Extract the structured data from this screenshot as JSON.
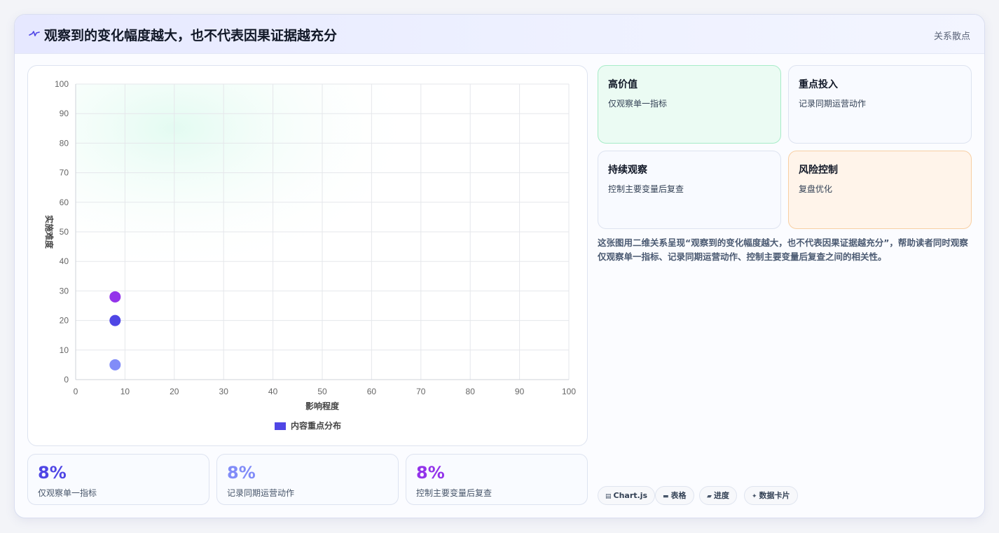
{
  "header": {
    "icon": "pulse-icon",
    "title": "观察到的变化幅度越大，也不代表因果证据越充分",
    "tag": "关系散点"
  },
  "chart_data": {
    "type": "scatter",
    "xlabel": "影响程度",
    "ylabel": "实施难度",
    "xlim": [
      0,
      100
    ],
    "ylim": [
      0,
      100
    ],
    "xticks": [
      0,
      10,
      20,
      30,
      40,
      50,
      60,
      70,
      80,
      90,
      100
    ],
    "yticks": [
      0,
      10,
      20,
      30,
      40,
      50,
      60,
      70,
      80,
      90,
      100
    ],
    "grid": true,
    "legend": "bottom",
    "series": [
      {
        "name": "内容重点分布",
        "color": "#4f46e5",
        "points": [
          {
            "x": 8,
            "y": 28,
            "color": "#9333ea"
          },
          {
            "x": 8,
            "y": 20,
            "color": "#4f46e5"
          },
          {
            "x": 8,
            "y": 5,
            "color": "#818cf8"
          }
        ]
      }
    ]
  },
  "stats": [
    {
      "value": "8%",
      "label": "仅观察单一指标",
      "color": "#4f46e5"
    },
    {
      "value": "8%",
      "label": "记录同期运营动作",
      "color": "#818cf8"
    },
    {
      "value": "8%",
      "label": "控制主要变量后复查",
      "color": "#9333ea"
    }
  ],
  "quadrants": [
    {
      "title": "高价值",
      "desc": "仅观察单一指标"
    },
    {
      "title": "重点投入",
      "desc": "记录同期运营动作"
    },
    {
      "title": "持续观察",
      "desc": "控制主要变量后复查"
    },
    {
      "title": "风险控制",
      "desc": "复盘优化"
    }
  ],
  "description": "这张图用二维关系呈现“观察到的变化幅度越大，也不代表因果证据越充分”，帮助读者同时观察仅观察单一指标、记录同期运营动作、控制主要变量后复查之间的相关性。",
  "pills": [
    {
      "icon": "chart-icon",
      "label": "Chart.js"
    },
    {
      "icon": "table-icon",
      "label": "表格"
    },
    {
      "icon": "progress-icon",
      "label": "进度"
    },
    {
      "icon": "card-icon",
      "label": "数据卡片"
    }
  ]
}
